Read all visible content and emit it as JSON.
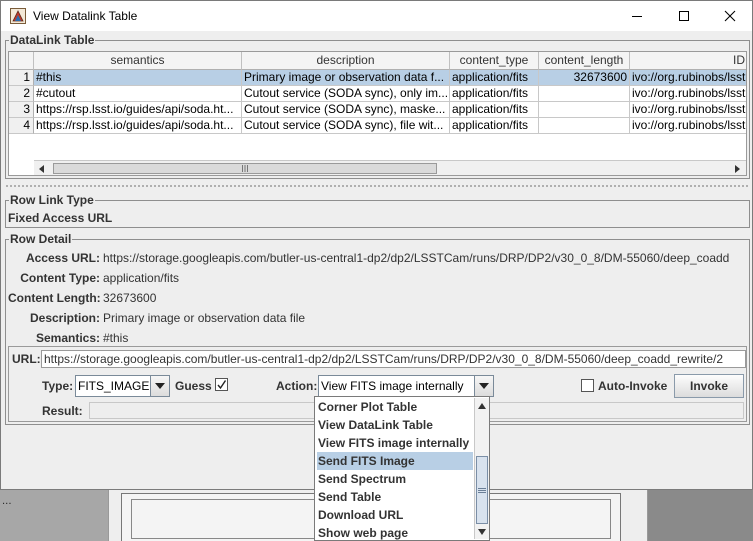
{
  "window": {
    "title": "View Datalink Table"
  },
  "datalink_panel": {
    "legend": "DataLink Table",
    "columns": [
      "semantics",
      "description",
      "content_type",
      "content_length",
      "ID"
    ],
    "rows": [
      {
        "num": "1",
        "semantics": "#this",
        "description": "Primary image or observation data f...",
        "content_type": "application/fits",
        "content_length": "32673600",
        "id": "ivo://org.rubinobs/lsst"
      },
      {
        "num": "2",
        "semantics": "#cutout",
        "description": "Cutout service (SODA sync), only im...",
        "content_type": "application/fits",
        "content_length": "",
        "id": "ivo://org.rubinobs/lsst"
      },
      {
        "num": "3",
        "semantics": "https://rsp.lsst.io/guides/api/soda.ht...",
        "description": "Cutout service (SODA sync), maske...",
        "content_type": "application/fits",
        "content_length": "",
        "id": "ivo://org.rubinobs/lsst"
      },
      {
        "num": "4",
        "semantics": "https://rsp.lsst.io/guides/api/soda.ht...",
        "description": "Cutout service (SODA sync), file wit...",
        "content_type": "application/fits",
        "content_length": "",
        "id": "ivo://org.rubinobs/lsst"
      }
    ],
    "selected_row": 1
  },
  "row_link_type": {
    "legend": "Row Link Type",
    "value": "Fixed Access URL"
  },
  "row_detail": {
    "legend": "Row Detail",
    "fields": [
      {
        "label": "Access URL:",
        "value": "https://storage.googleapis.com/butler-us-central1-dp2/dp2/LSSTCam/runs/DRP/DP2/v30_0_8/DM-55060/deep_coadd"
      },
      {
        "label": "Content Type:",
        "value": "application/fits"
      },
      {
        "label": "Content Length:",
        "value": "32673600"
      },
      {
        "label": "Description:",
        "value": "Primary image or observation data file"
      },
      {
        "label": "Semantics:",
        "value": "#this"
      }
    ],
    "url_label": "URL:",
    "url_value": "https://storage.googleapis.com/butler-us-central1-dp2/dp2/LSSTCam/runs/DRP/DP2/v30_0_8/DM-55060/deep_coadd_rewrite/2",
    "type_label": "Type:",
    "type_value": "FITS_IMAGE",
    "guess_label": "Guess",
    "guess_checked": true,
    "action_label": "Action:",
    "action_value": "View FITS image internally",
    "auto_invoke_label": "Auto-Invoke",
    "auto_invoke_checked": false,
    "invoke_label": "Invoke",
    "result_label": "Result:",
    "result_value": ""
  },
  "action_dropdown": {
    "options": [
      "Corner Plot Table",
      "View DataLink Table",
      "View FITS image internally",
      "Send FITS Image",
      "Send Spectrum",
      "Send Table",
      "Download URL",
      "Show web page"
    ],
    "highlighted": "Send FITS Image"
  },
  "background_window": {
    "partial_text": "..."
  },
  "colors": {
    "selection": "#b8cfe5",
    "panel_bg": "#eeeeee",
    "border": "#8e8e8e"
  }
}
